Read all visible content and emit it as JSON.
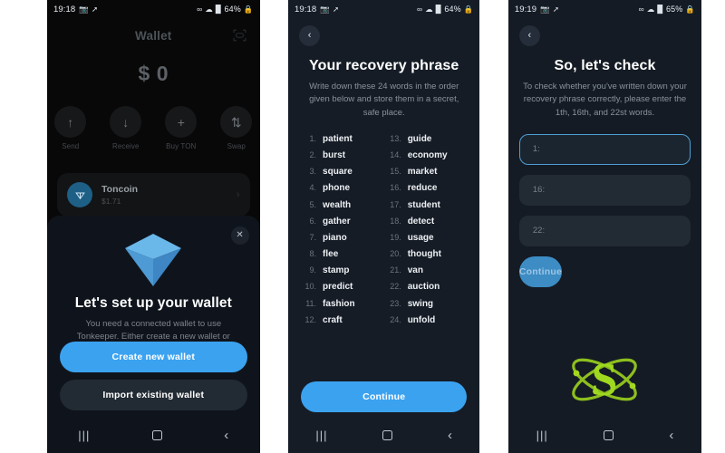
{
  "panel1": {
    "status": {
      "time": "19:18",
      "battery": "64%",
      "icons": [
        "photo-icon",
        "location-icon",
        "link-icon",
        "wifi-icon",
        "signal-icon",
        "lock-icon"
      ]
    },
    "header": {
      "title": "Wallet",
      "scan_icon": "scan-icon"
    },
    "balance": "$ 0",
    "actions": [
      {
        "label": "Send",
        "icon": "arrow-up-icon",
        "glyph": "↑"
      },
      {
        "label": "Receive",
        "icon": "arrow-down-icon",
        "glyph": "↓"
      },
      {
        "label": "Buy TON",
        "icon": "plus-icon",
        "glyph": "+"
      },
      {
        "label": "Swap",
        "icon": "swap-arrows-icon",
        "glyph": "⇅"
      }
    ],
    "token": {
      "name": "Toncoin",
      "price": "$1.71",
      "logo_icon": "toncoin-icon",
      "chevron": "›"
    },
    "sheet": {
      "close_icon": "close-icon",
      "illustration": "diamond-gem-icon",
      "title": "Let's set up your wallet",
      "subtitle": "You need a connected wallet to use Tonkeeper. Either create a new wallet or import an existing one.",
      "primary_button": "Create new wallet",
      "secondary_button": "Import existing wallet"
    }
  },
  "panel2": {
    "status": {
      "time": "19:18",
      "battery": "64%"
    },
    "back_icon": "chevron-left-icon",
    "title": "Your recovery phrase",
    "subtitle": "Write down these 24 words in the order given below and store them in a secret, safe place.",
    "words_left": [
      {
        "num": "1.",
        "word": "patient"
      },
      {
        "num": "2.",
        "word": "burst"
      },
      {
        "num": "3.",
        "word": "square"
      },
      {
        "num": "4.",
        "word": "phone"
      },
      {
        "num": "5.",
        "word": "wealth"
      },
      {
        "num": "6.",
        "word": "gather"
      },
      {
        "num": "7.",
        "word": "piano"
      },
      {
        "num": "8.",
        "word": "flee"
      },
      {
        "num": "9.",
        "word": "stamp"
      },
      {
        "num": "10.",
        "word": "predict"
      },
      {
        "num": "11.",
        "word": "fashion"
      },
      {
        "num": "12.",
        "word": "craft"
      }
    ],
    "words_right": [
      {
        "num": "13.",
        "word": "guide"
      },
      {
        "num": "14.",
        "word": "economy"
      },
      {
        "num": "15.",
        "word": "market"
      },
      {
        "num": "16.",
        "word": "reduce"
      },
      {
        "num": "17.",
        "word": "student"
      },
      {
        "num": "18.",
        "word": "detect"
      },
      {
        "num": "19.",
        "word": "usage"
      },
      {
        "num": "20.",
        "word": "thought"
      },
      {
        "num": "21.",
        "word": "van"
      },
      {
        "num": "22.",
        "word": "auction"
      },
      {
        "num": "23.",
        "word": "swing"
      },
      {
        "num": "24.",
        "word": "unfold"
      }
    ],
    "continue_button": "Continue"
  },
  "panel3": {
    "status": {
      "time": "19:19",
      "battery": "65%"
    },
    "back_icon": "chevron-left-icon",
    "title": "So, let's check",
    "subtitle": "To check whether you've written down your recovery phrase correctly, please enter the 1th, 16th, and  22st words.",
    "fields": [
      {
        "label": "1:",
        "value": "",
        "focused": true
      },
      {
        "label": "16:",
        "value": "",
        "focused": false
      },
      {
        "label": "22:",
        "value": "",
        "focused": false
      }
    ],
    "continue_button": "Continue",
    "watermark": "atom-s-logo-icon"
  },
  "navbar": {
    "recents": "|||",
    "home": "home-square-icon",
    "back": "‹"
  },
  "colors": {
    "accent_blue": "#3ba2f0",
    "panel1_bg": "#080809",
    "panel_bg": "#151c26",
    "sheet_bg": "#0f141c",
    "field_bg": "#222a34",
    "logo_green": "#9ccc22"
  }
}
